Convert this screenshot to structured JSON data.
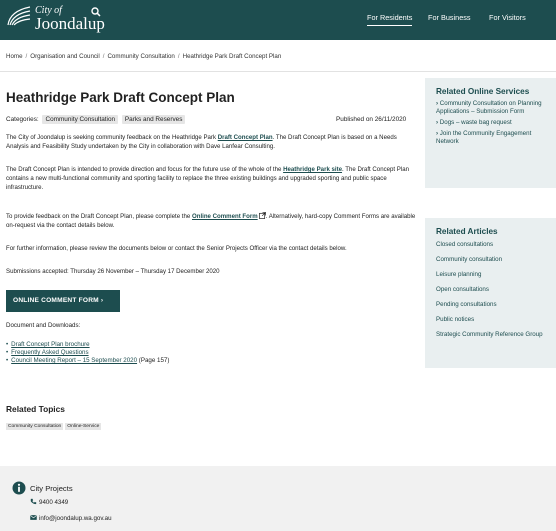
{
  "header": {
    "logo_line1": "City of",
    "logo_line2": "Joondalup",
    "nav": [
      {
        "label": "For Residents"
      },
      {
        "label": "For Business"
      },
      {
        "label": "For Visitors"
      }
    ],
    "brand_color": "#1d4d4f"
  },
  "breadcrumb": {
    "items": [
      "Home",
      "Organisation and Council",
      "Community Consultation",
      "Heathridge Park Draft Concept Plan"
    ]
  },
  "main": {
    "title": "Heathridge Park Draft Concept Plan",
    "categories_label": "Categories:",
    "categories": [
      "Community Consultation",
      "Parks and Reserves"
    ],
    "published": "Published on 26/11/2020",
    "p1_a": "The City of Joondalup is seeking community feedback on the Heathridge Park ",
    "p1_link": "Draft Concept Plan",
    "p1_b": ". The Draft Concept Plan is based on a Needs Analysis and Feasibility Study undertaken by the City in collaboration with Dave Lanfear Consulting.",
    "p2_a": "The Draft Concept Plan is intended to provide direction and focus for the future use of the whole of the ",
    "p2_link": "Heathridge Park site",
    "p2_b": ". The Draft Concept Plan contains a new multi-functional community and sporting facility to replace the three existing buildings and upgraded sporting and public space infrastructure.",
    "p3_a": "To provide feedback on the Draft Concept Plan, please complete the ",
    "p3_link": "Online Comment Form",
    "p3_b": ". Alternatively, hard-copy Comment Forms are available on-request via the contact details below.",
    "p4": "For further information, please review the documents below or contact the Senior Projects Officer via the contact details below.",
    "p5": "Submissions accepted: Thursday 26 November – Thursday 17 December 2020",
    "cta_label": "ONLINE COMMENT FORM  ›",
    "downloads_label": "Document and Downloads:",
    "docs": [
      {
        "link": "Draft Concept Plan brochure",
        "suffix": ""
      },
      {
        "link": "Frequently Asked Questions",
        "suffix": ""
      },
      {
        "link": "Council Meeting Report – 15 September 2020",
        "suffix": " (Page 157)"
      }
    ],
    "related_topics_title": "Related Topics",
    "topics": [
      "Community Consultation",
      "Online-Service"
    ]
  },
  "sidebar": {
    "services_title": "Related Online Services",
    "services": [
      "Community Consultation on Planning Applications – Submission Form",
      "Dogs – waste bag request",
      "Join the Community Engagement Network"
    ],
    "articles_title": "Related Articles",
    "articles": [
      "Closed consultations",
      "Community consultation",
      "Leisure planning",
      "Open consultations",
      "Pending consultations",
      "Public notices",
      "Strategic Community Reference Group"
    ]
  },
  "footer": {
    "title": "City Projects",
    "phone": "9400 4349",
    "email": "info@joondalup.wa.gov.au"
  }
}
